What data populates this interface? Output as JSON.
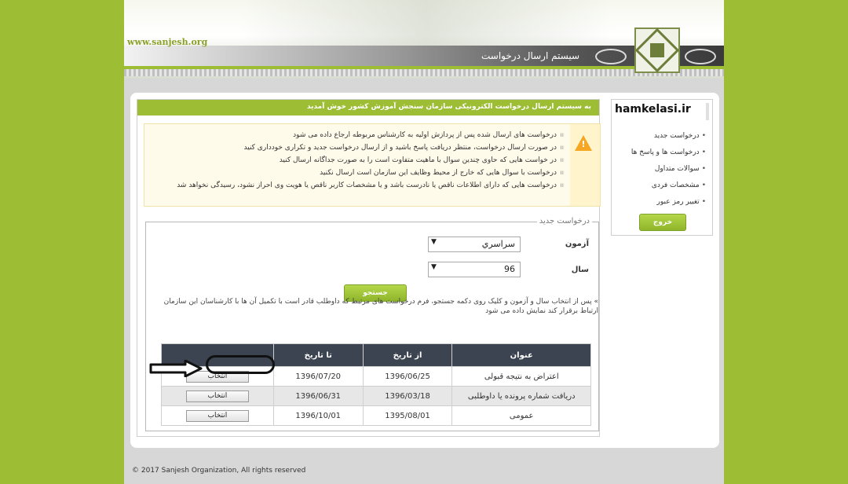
{
  "header": {
    "site_url": "www.sanjesh.org",
    "system_title": "سیستم ارسال درخواست"
  },
  "welcome": "به سیستم ارسال درخواست الکترونیکی سازمان سنجش آموزش کشور خوش آمدید",
  "notices": [
    "درخواست های ارسال شده پس از پردازش اولیه به کارشناس مربوطه ارجاع داده می شود",
    "در صورت ارسال درخواست، منتظر دریافت پاسخ باشید و از ارسال درخواست جدید و تکراری خودداری کنید",
    "در خواست هایی که حاوی چندین سوال با ماهیت متفاوت است را به صورت جداگانه ارسال کنید",
    "درخواست با سوال هایی که خارج از محیط وظایف این سازمان است ارسال نکنید",
    "درخواست هایی که دارای اطلاعات ناقص یا نادرست باشد و یا مشخصات کاربر ناقص یا هویت وی احراز نشود، رسیدگی نخواهد شد"
  ],
  "form": {
    "legend": "درخواست جدید",
    "exam_label": "آزمون",
    "exam_value": "سراسري",
    "year_label": "سال",
    "year_value": "96",
    "search_label": "جستجو",
    "note": "» پس از انتخاب سال و آزمون و کلیک روی دکمه جستجو، فرم درخواست های مرتبط که داوطلب قادر است با تکمیل آن ها با کارشناسان این سازمان ارتباط برقرار کند نمایش داده می شود"
  },
  "table": {
    "headers": [
      "عنوان",
      "از تاریخ",
      "تا تاریخ",
      ""
    ],
    "select_label": "انتخاب",
    "rows": [
      {
        "title": "اعتراض به نتیجه قبولی",
        "from": "1396/06/25",
        "to": "1396/07/20"
      },
      {
        "title": "دریافت شماره پرونده یا داوطلبی",
        "from": "1396/03/18",
        "to": "1396/06/31"
      },
      {
        "title": "عمومی",
        "from": "1395/08/01",
        "to": "1396/10/01"
      }
    ]
  },
  "sidebar": {
    "brand": "hamkelasi.ir",
    "items": [
      "درخواست جدید",
      "درخواست ها و پاسخ ها",
      "سوالات متداول",
      "مشخصات فردی",
      "تغییر رمز عبور"
    ],
    "logout_label": "خروج"
  },
  "footer": "© 2017 Sanjesh Organization, All rights reserved",
  "colors": {
    "accent": "#9cbd34",
    "table_header": "#3b4450",
    "warning": "#f5a623"
  }
}
